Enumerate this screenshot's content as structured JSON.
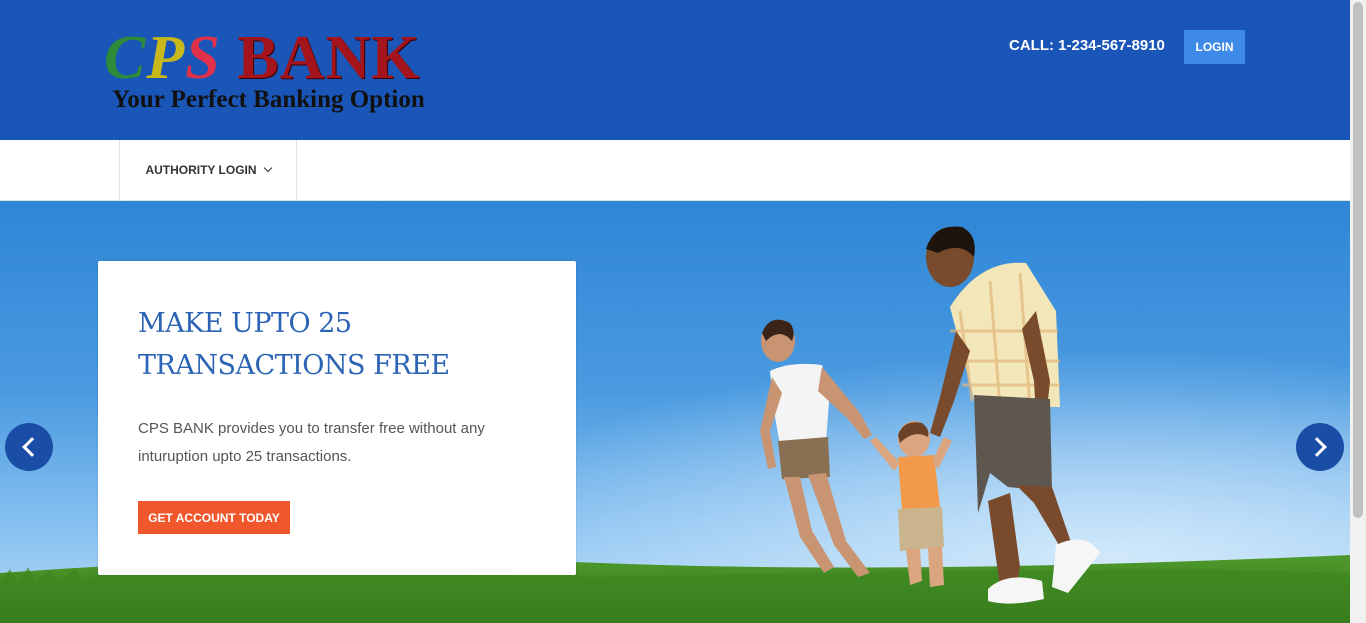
{
  "header": {
    "logo": {
      "cps": "CPS",
      "bank": "BANK",
      "tagline": "Your Perfect Banking Option"
    },
    "call_text": "CALL: 1-234-567-8910",
    "login_label": "LOGIN"
  },
  "nav": {
    "items": [
      {
        "label": "AUTHORITY LOGIN",
        "icon": "chevron-down-icon"
      }
    ]
  },
  "slider": {
    "title": "MAKE UPTO 25 TRANSACTIONS FREE",
    "text": "CPS BANK provides you to transfer free without any inturuption upto 25 transactions.",
    "cta_label": "GET ACCOUNT TODAY",
    "prev_icon": "chevron-left-icon",
    "next_icon": "chevron-right-icon"
  },
  "colors": {
    "header_bg": "#1a56b8",
    "accent": "#f0572d",
    "login_btn": "#3d8ae8",
    "title": "#2b63b5",
    "arrow_bg": "#1a4ea6"
  }
}
